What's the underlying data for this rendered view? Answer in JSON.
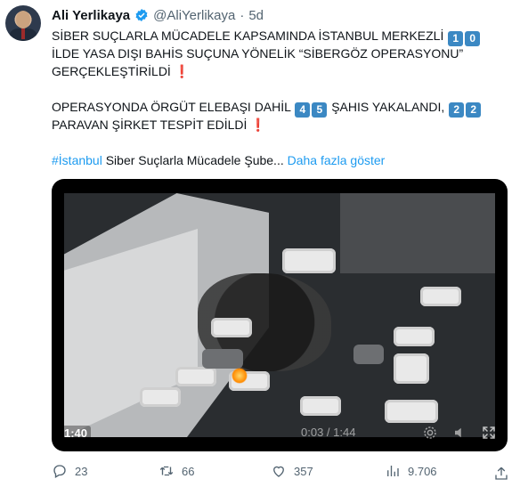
{
  "author": {
    "name": "Ali Yerlikaya",
    "handle": "@AliYerlikaya",
    "separator": "·",
    "time": "5d"
  },
  "tweet": {
    "line1_prefix": "SİBER SUÇLARLA MÜCADELE KAPSAMINDA İSTANBUL MERKEZLİ",
    "line1_keys": [
      "1",
      "0"
    ],
    "line2": "İLDE YASA DIŞI BAHİS SUÇUNA YÖNELİK “SİBERGÖZ OPERASYONU”",
    "line3": "GERÇEKLEŞTİRİLDİ",
    "exclamation": "❗",
    "line4_prefix": "OPERASYONDA ÖRGÜT ELEBAŞI DAHİL",
    "line4_keys": [
      "4",
      "5"
    ],
    "line4_suffix": "ŞAHIS YAKALANDI,",
    "line4_keys2": [
      "2",
      "2"
    ],
    "line5": "PARAVAN ŞİRKET TESPİT EDİLDİ",
    "hashtag": "#İstanbul",
    "line6_text": "Siber Suçlarla Mücadele Şube...",
    "show_more": "Daha fazla göster"
  },
  "video": {
    "duration": "1:40",
    "timestamp": "0:03 / 1:44"
  },
  "actions": {
    "replies": "23",
    "retweets": "66",
    "likes": "357",
    "views": "9.706"
  },
  "colors": {
    "accent": "#1d9bf0",
    "muted": "#536471",
    "keycap": "#3b88c3",
    "exclamation": "#d4212f"
  },
  "icons": {
    "verified": "verified-badge-icon",
    "reply": "reply-icon",
    "retweet": "retweet-icon",
    "like": "heart-icon",
    "views": "views-chart-icon",
    "settings": "gear-icon",
    "fullscreen": "fullscreen-icon",
    "mute": "speaker-icon"
  }
}
